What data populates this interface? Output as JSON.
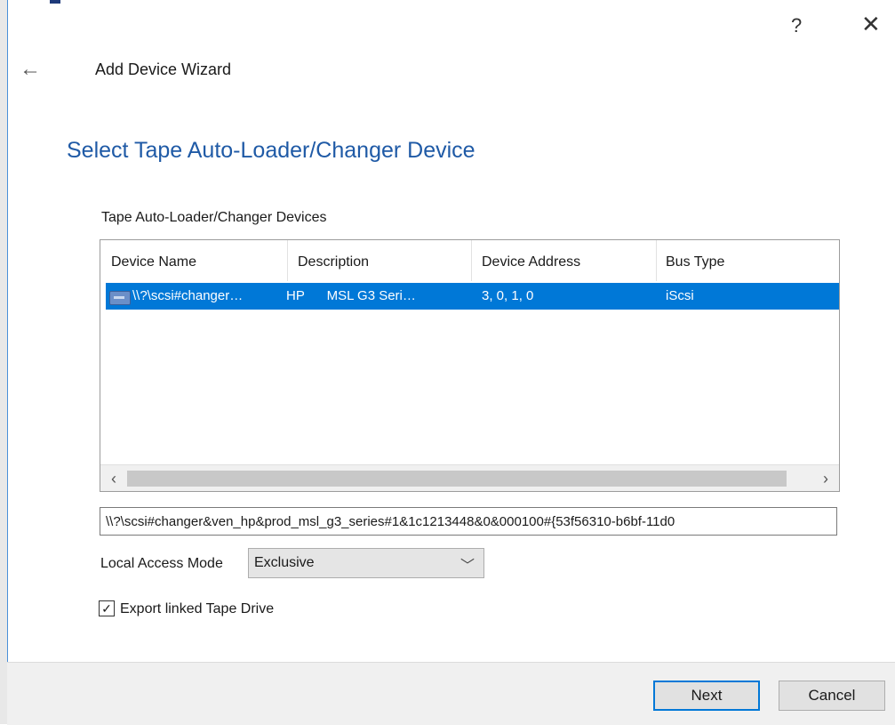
{
  "window": {
    "help_glyph": "?",
    "close_glyph": "✕",
    "back_glyph": "←"
  },
  "wizard": {
    "title": "Add Device Wizard",
    "page_title": "Select Tape Auto-Loader/Changer Device"
  },
  "devices": {
    "group_label": "Tape Auto-Loader/Changer Devices",
    "columns": [
      "Device Name",
      "Description",
      "Device Address",
      "Bus Type"
    ],
    "rows": [
      {
        "device_name": "\\\\?\\scsi#changer…",
        "description": "HP      MSL G3 Seri…",
        "device_address": "3, 0, 1, 0",
        "bus_type": "iScsi",
        "selected": true
      }
    ]
  },
  "path": {
    "value": "\\\\?\\scsi#changer&ven_hp&prod_msl_g3_series#1&1c1213448&0&000100#{53f56310-b6bf-11d0"
  },
  "access_mode": {
    "label": "Local Access Mode",
    "value": "Exclusive"
  },
  "export_option": {
    "label": "Export linked Tape Drive",
    "checked": true,
    "check_glyph": "✓"
  },
  "buttons": {
    "next": "Next",
    "cancel": "Cancel"
  },
  "colors": {
    "accent": "#0078d7",
    "title": "#1f5aa6"
  }
}
